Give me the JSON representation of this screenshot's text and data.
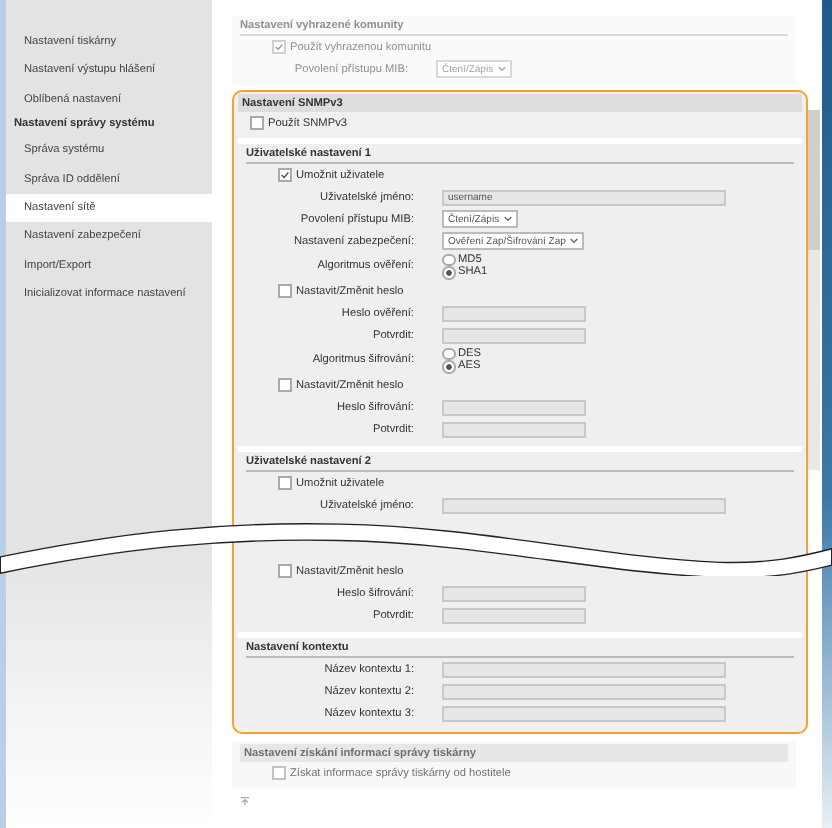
{
  "sidebar": {
    "items": [
      {
        "label": "Nastavení tiskárny",
        "kind": "item",
        "selected": false
      },
      {
        "label": "Nastavení výstupu hlášení",
        "kind": "item",
        "selected": false
      },
      {
        "label": "Oblíbená nastavení",
        "kind": "item",
        "selected": false
      },
      {
        "label": "Nastavení správy systému",
        "kind": "header"
      },
      {
        "label": "Správa systému",
        "kind": "item",
        "selected": false
      },
      {
        "label": "Správa ID oddělení",
        "kind": "item",
        "selected": false
      },
      {
        "label": "Nastavení sítě",
        "kind": "item",
        "selected": true
      },
      {
        "label": "Nastavení zabezpečení",
        "kind": "item",
        "selected": false
      },
      {
        "label": "Import/Export",
        "kind": "item",
        "selected": false
      },
      {
        "label": "Inicializovat informace nastavení",
        "kind": "item",
        "selected": false
      }
    ]
  },
  "community": {
    "title": "Nastavení vyhrazené komunity",
    "use": {
      "label": "Použít vyhrazenou komunitu",
      "checked": true
    },
    "mib": {
      "label": "Povolení přístupu MIB:",
      "value": "Čtení/Zápis"
    }
  },
  "snmpv3": {
    "title": "Nastavení SNMPv3",
    "use": {
      "label": "Použít SNMPv3",
      "checked": false
    },
    "users": [
      {
        "title": "Uživatelské nastavení 1",
        "rows": [
          {
            "kind": "check",
            "label": "Umožnit uživatele",
            "checked": true
          },
          {
            "kind": "text",
            "label": "Uživatelské jméno:",
            "value": "username",
            "wide": true
          },
          {
            "kind": "select",
            "label": "Povolení přístupu MIB:",
            "value": "Čtení/Zápis"
          },
          {
            "kind": "select",
            "label": "Nastavení zabezpečení:",
            "value": "Ověření Zap/Šifrování Zap"
          },
          {
            "kind": "radio",
            "label": "Algoritmus ověření:",
            "options": [
              {
                "label": "MD5",
                "selected": false
              },
              {
                "label": "SHA1",
                "selected": true
              }
            ]
          },
          {
            "kind": "check",
            "label": "Nastavit/Změnit heslo",
            "checked": false
          },
          {
            "kind": "text",
            "label": "Heslo ověření:"
          },
          {
            "kind": "text",
            "label": "Potvrdit:"
          },
          {
            "kind": "radio",
            "label": "Algoritmus šifrování:",
            "options": [
              {
                "label": "DES",
                "selected": false
              },
              {
                "label": "AES",
                "selected": true
              }
            ]
          },
          {
            "kind": "check",
            "label": "Nastavit/Změnit heslo",
            "checked": false
          },
          {
            "kind": "text",
            "label": "Heslo šifrování:"
          },
          {
            "kind": "text",
            "label": "Potvrdit:"
          }
        ]
      },
      {
        "title": "Uživatelské nastavení 2",
        "rows": [
          {
            "kind": "check",
            "label": "Umožnit uživatele",
            "checked": false
          },
          {
            "kind": "text",
            "label": "Uživatelské jméno:",
            "wide": true
          },
          {
            "kind": "break"
          },
          {
            "kind": "check",
            "label": "Nastavit/Změnit heslo",
            "checked": false
          },
          {
            "kind": "text",
            "label": "Heslo šifrování:"
          },
          {
            "kind": "text",
            "label": "Potvrdit:"
          }
        ]
      }
    ],
    "context": {
      "title": "Nastavení kontextu",
      "names": [
        "Název kontextu 1:",
        "Název kontextu 2:",
        "Název kontextu 3:"
      ]
    }
  },
  "mgmt": {
    "title": "Nastavení získání informací správy tiskárny",
    "use": {
      "label": "Získat informace správy tiskárny od hostitele",
      "checked": false
    }
  }
}
